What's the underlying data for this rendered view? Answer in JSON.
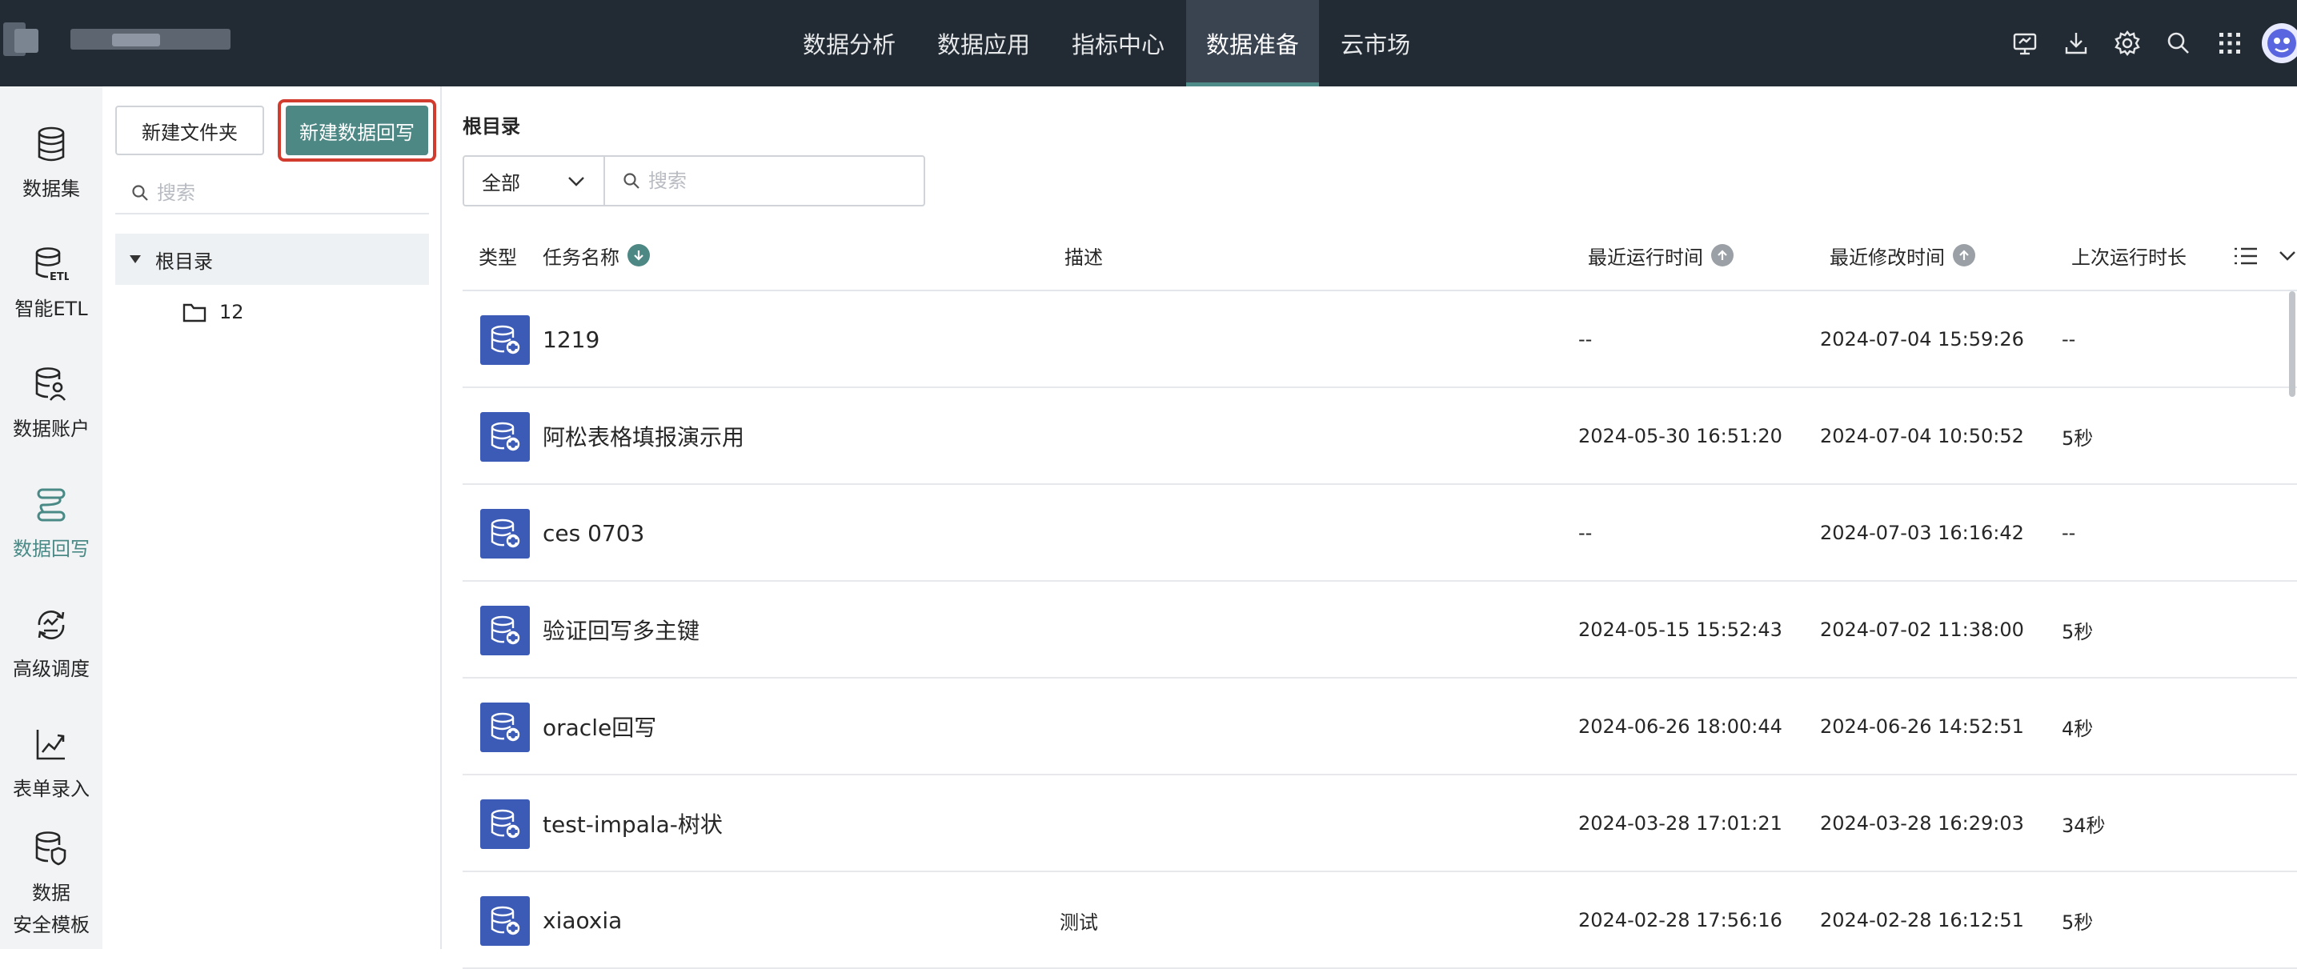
{
  "topbar": {
    "nav": [
      {
        "label": "数据分析",
        "active": false
      },
      {
        "label": "数据应用",
        "active": false
      },
      {
        "label": "指标中心",
        "active": false
      },
      {
        "label": "数据准备",
        "active": true
      },
      {
        "label": "云市场",
        "active": false
      }
    ],
    "icons": [
      "monitor-icon",
      "download-icon",
      "settings-icon",
      "search-icon",
      "apps-grid-icon"
    ],
    "colors": {
      "bar": "#222a33",
      "active_tab": "#3a4350",
      "accent": "#4f8c89"
    }
  },
  "rail": {
    "items": [
      {
        "label": "数据集",
        "icon": "database-icon",
        "active": false
      },
      {
        "label": "智能ETL",
        "icon": "etl-icon",
        "active": false
      },
      {
        "label": "数据账户",
        "icon": "data-account-icon",
        "active": false
      },
      {
        "label": "数据回写",
        "icon": "writeback-icon",
        "active": true
      },
      {
        "label": "高级调度",
        "icon": "schedule-icon",
        "active": false
      },
      {
        "label": "表单录入",
        "icon": "form-entry-icon",
        "active": false
      },
      {
        "label_line1": "数据",
        "label_line2": "安全模板",
        "icon": "security-template-icon",
        "active": false
      }
    ]
  },
  "folder_panel": {
    "new_folder_label": "新建文件夹",
    "new_writeback_label": "新建数据回写",
    "search_placeholder": "搜索",
    "tree_root": "根目录",
    "tree_children": [
      "12"
    ]
  },
  "main": {
    "breadcrumb": "根目录",
    "filter_value": "全部",
    "search_placeholder": "搜索",
    "columns": {
      "type": "类型",
      "name": "任务名称",
      "desc": "描述",
      "last_run": "最近运行时间",
      "last_modified": "最近修改时间",
      "last_duration": "上次运行时长"
    },
    "rows": [
      {
        "name": "1219",
        "desc": "",
        "last_run": "--",
        "last_modified": "2024-07-04 15:59:26",
        "duration": "--"
      },
      {
        "name": "阿松表格填报演示用",
        "desc": "",
        "last_run": "2024-05-30 16:51:20",
        "last_modified": "2024-07-04 10:50:52",
        "duration": "5秒"
      },
      {
        "name": "ces 0703",
        "desc": "",
        "last_run": "--",
        "last_modified": "2024-07-03 16:16:42",
        "duration": "--"
      },
      {
        "name": "验证回写多主键",
        "desc": "",
        "last_run": "2024-05-15 15:52:43",
        "last_modified": "2024-07-02 11:38:00",
        "duration": "5秒"
      },
      {
        "name": "oracle回写",
        "desc": "",
        "last_run": "2024-06-26 18:00:44",
        "last_modified": "2024-06-26 14:52:51",
        "duration": "4秒"
      },
      {
        "name": "test-impala-树状",
        "desc": "",
        "last_run": "2024-03-28 17:01:21",
        "last_modified": "2024-03-28 16:29:03",
        "duration": "34秒"
      },
      {
        "name": "xiaoxia",
        "desc": "测试",
        "last_run": "2024-02-28 17:56:16",
        "last_modified": "2024-02-28 16:12:51",
        "duration": "5秒"
      }
    ]
  }
}
